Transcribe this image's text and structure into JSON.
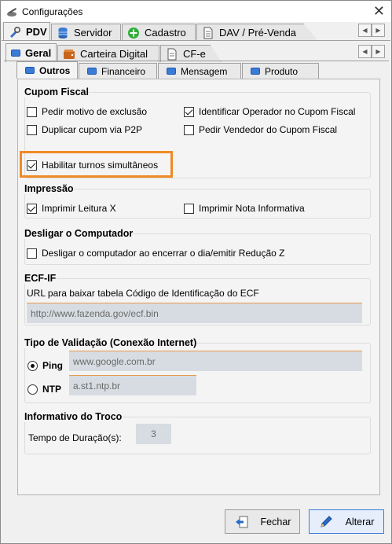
{
  "window": {
    "title": "Configurações",
    "close_symbol": "✕"
  },
  "main_tabs": [
    {
      "label": "PDV",
      "icon": "tools-icon",
      "active": true
    },
    {
      "label": "Servidor",
      "icon": "database-icon",
      "active": false
    },
    {
      "label": "Cadastro",
      "icon": "add-icon",
      "active": false
    },
    {
      "label": "DAV / Pré-Venda",
      "icon": "document-icon",
      "active": false
    }
  ],
  "sub_tabs": [
    {
      "label": "Geral",
      "icon": "blue-tab-icon",
      "active": true
    },
    {
      "label": "Carteira Digital",
      "icon": "wallet-icon",
      "active": false
    },
    {
      "label": "CF-e",
      "icon": "document-icon",
      "active": false
    }
  ],
  "inner_tabs": [
    {
      "label": "Outros",
      "active": true
    },
    {
      "label": "Financeiro",
      "active": false
    },
    {
      "label": "Mensagem",
      "active": false
    },
    {
      "label": "Produto",
      "active": false
    }
  ],
  "scroll": {
    "left": "◀",
    "right": "▶"
  },
  "cupom_fiscal": {
    "title": "Cupom Fiscal",
    "options": [
      {
        "label": "Pedir motivo de exclusão",
        "checked": false
      },
      {
        "label": "Identificar Operador no Cupom Fiscal",
        "checked": true
      },
      {
        "label": "Duplicar cupom via P2P",
        "checked": false
      },
      {
        "label": "Pedir Vendedor do Cupom Fiscal",
        "checked": false
      },
      {
        "label": "Habilitar turnos simultâneos",
        "checked": true
      }
    ]
  },
  "impressao": {
    "title": "Impressão",
    "options": [
      {
        "label": "Imprimir Leitura X",
        "checked": true
      },
      {
        "label": "Imprimir Nota Informativa",
        "checked": false
      }
    ]
  },
  "desligar": {
    "title": "Desligar o Computador",
    "options": [
      {
        "label": "Desligar o computador ao encerrar o dia/emitir Redução Z",
        "checked": false
      }
    ]
  },
  "ecf": {
    "title": "ECF-IF",
    "url_label": "URL para baixar tabela Código de Identificação do ECF",
    "url_value": "http://www.fazenda.gov/ecf.bin"
  },
  "validacao": {
    "title": "Tipo de Validação (Conexão Internet)",
    "ping_label": "Ping",
    "ping_value": "www.google.com.br",
    "ntp_label": "NTP",
    "ntp_value": "a.st1.ntp.br",
    "selected": "Ping"
  },
  "troco": {
    "title": "Informativo do Troco",
    "duration_label": "Tempo de Duração(s):",
    "duration_value": "3"
  },
  "footer": {
    "cancel_label": "Fechar",
    "ok_label": "Alterar"
  },
  "colors": {
    "highlight": "#f08a24",
    "accent": "#3d7bd8"
  }
}
